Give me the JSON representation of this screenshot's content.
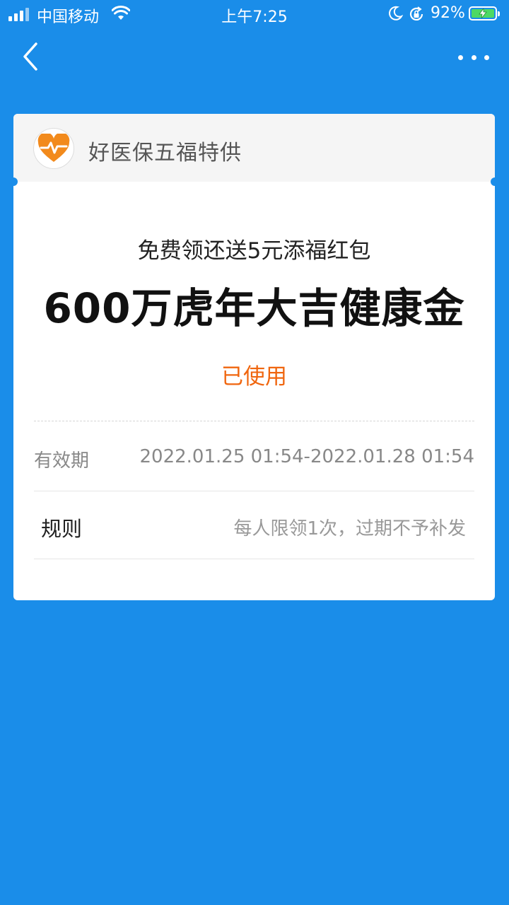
{
  "status_bar": {
    "carrier": "中国移动",
    "time": "上午7:25",
    "battery_percent": "92%"
  },
  "card": {
    "brand": "好医保五福特供",
    "subtitle": "免费领还送5元添福红包",
    "title": "600万虎年大吉健康金",
    "status": "已使用",
    "validity_label": "有效期",
    "validity_value": "2022.01.25 01:54-2022.01.28 01:54",
    "rules_label": "规则",
    "rules_value": "每人限领1次，过期不予补发"
  },
  "colors": {
    "background": "#1a8de9",
    "status_used": "#f0660f",
    "logo_orange": "#f28a1c"
  },
  "icons": {
    "back": "back-chevron-icon",
    "more": "more-dots-icon",
    "logo": "heart-pulse-icon"
  }
}
